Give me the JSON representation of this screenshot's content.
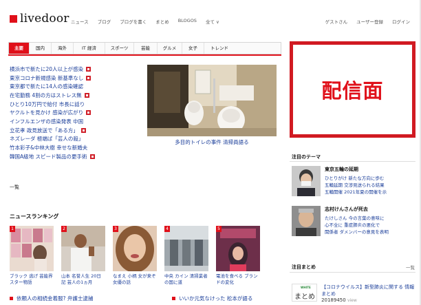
{
  "header": {
    "logo_text": "livedoor",
    "nav": [
      "ニュース",
      "ブログ",
      "ブログを書く",
      "まとめ",
      "BLOGOS",
      "全て ∨"
    ],
    "user_links": [
      "ゲストさん",
      "ユーザー登録",
      "ログイン"
    ]
  },
  "tabs": [
    "主要",
    "国内",
    "海外",
    "IT 経済",
    "スポーツ",
    "芸能",
    "グルメ",
    "女子",
    "トレンド"
  ],
  "headlines": [
    {
      "text": "横浜市で新たに20人以上が感染",
      "photo": true
    },
    {
      "text": "東京コロナ新規感染 新基準なし",
      "photo": true
    },
    {
      "text": "東京都で新たに14人の感染確認",
      "photo": false
    },
    {
      "text": "在宅勤務 4割の方はストレス無",
      "photo": true
    },
    {
      "text": "ひとり10万円で給付 市長に話り",
      "photo": false
    },
    {
      "text": "ヤクルトを見かけ 感染が広がり",
      "photo": true
    },
    {
      "text": "インフルエンザの感染発表 中国",
      "photo": false
    },
    {
      "text": "立花孝 政見放送で「ある方」",
      "photo": true
    },
    {
      "text": "ネズレーダ 極端ば「芸人の殺」",
      "photo": false
    },
    {
      "text": "竹本彩子&中林大樹 幸せな新婚夫",
      "photo": false
    },
    {
      "text": "韓国A級地 スピード製品の更手術",
      "photo": true
    }
  ],
  "more_link": "一覧",
  "feature": {
    "caption": "多目的トイレの事件 清掃員語る"
  },
  "ranking": {
    "title": "ニュースランキング",
    "items": [
      {
        "num": "1",
        "caption": "ブラック 逃げ 芸能界 スター物語"
      },
      {
        "num": "2",
        "caption": "山本 名誉人生 20日記 芸人の1ヵ月"
      },
      {
        "num": "3",
        "caption": "なまえ 小柄 女が来ぞ 女優の話"
      },
      {
        "num": "4",
        "caption": "中央 カイン 清掃業者 の国に道"
      },
      {
        "num": "5",
        "caption": "電池を食べる ブランドの変化"
      }
    ]
  },
  "bottom_news": [
    "依頼人の相続金着服? 弁護士逮捕",
    "いいか元気なけった 松本が語る"
  ],
  "ad": {
    "text": "配信面"
  },
  "right": {
    "themes_title": "注目のテーマ",
    "themes": [
      {
        "head": "東京五輪の延期",
        "lines": [
          "ひとりがけ 新たな方向に歩む",
          "五輪延期 交渉見送られる結果",
          "五輪開催 2021年夏の開催を示"
        ]
      },
      {
        "head": "志村けんさんが死去",
        "lines": [
          "たけしさん 今の言葉の意味に",
          "心不全に 重症肺炎の悪化で",
          "関係者 ダメンバーの意見を表明"
        ]
      }
    ],
    "matome_title": "注目まとめ",
    "matome_more": "一覧",
    "matome": {
      "logo_small": "WHITE",
      "logo_big": "まとめ",
      "text": "【コロナウイルス】新型肺炎に関する 情報まとめ",
      "count": "20189450",
      "count_unit": "view"
    }
  }
}
